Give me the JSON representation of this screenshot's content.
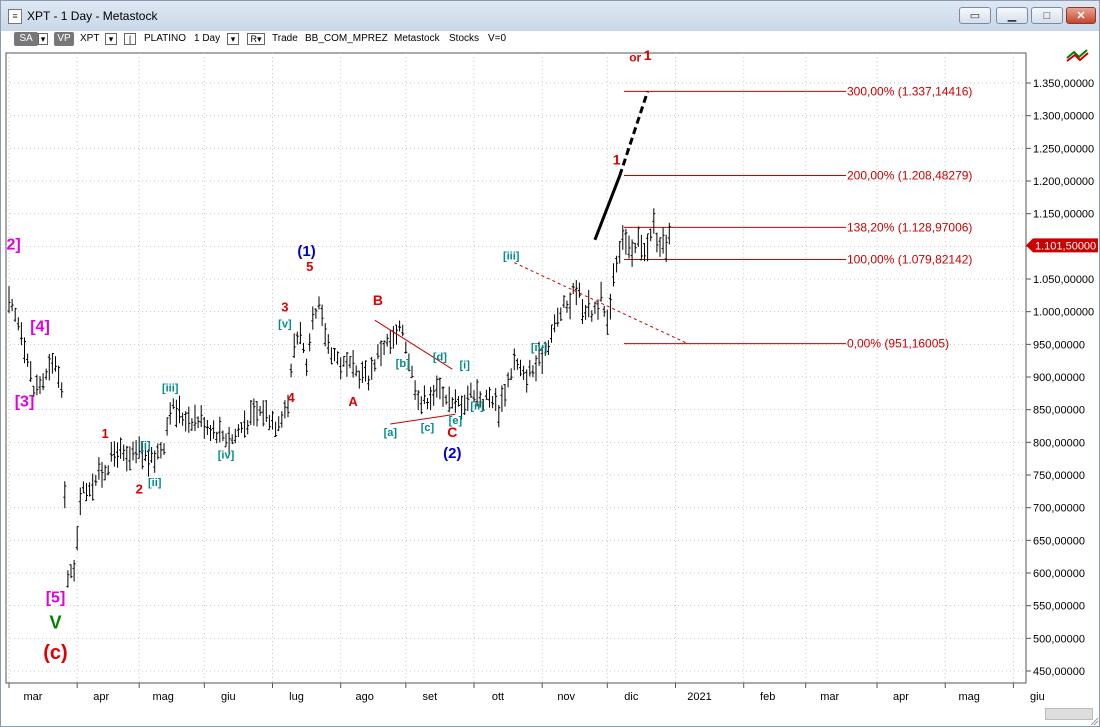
{
  "window": {
    "title": "XPT - 1 Day - Metastock"
  },
  "toolbar": {
    "sa": "SA",
    "vp": "VP",
    "symbol": "XPT",
    "name": "PLATINO",
    "period": "1 Day",
    "r": "R",
    "mode": "Trade",
    "bb": "BB_COM_MPREZ",
    "src": "Metastock",
    "cat": "Stocks",
    "v": "V=0"
  },
  "chart_data": {
    "type": "ohlc",
    "symbol": "XPT",
    "name": "PLATINO",
    "period": "1 Day",
    "last_value": 1101.5,
    "last_label": "1.101,50000",
    "ylim": [
      420,
      1420
    ],
    "y_ticks": [
      450,
      500,
      550,
      600,
      650,
      700,
      750,
      800,
      850,
      900,
      950,
      1000,
      1050,
      1100,
      1150,
      1200,
      1250,
      1300,
      1350
    ],
    "y_tick_labels": [
      "450,00000",
      "500,00000",
      "550,00000",
      "600,00000",
      "650,00000",
      "700,00000",
      "750,00000",
      "800,00000",
      "850,00000",
      "900,00000",
      "950,00000",
      "1.000,00000",
      "1.050,00000",
      "1.100,00000",
      "1.150,00000",
      "1.200,00000",
      "1.250,00000",
      "1.300,00000",
      "1.350,00000"
    ],
    "grid": true,
    "months": [
      {
        "label": "mar",
        "idx": 0
      },
      {
        "label": "apr",
        "idx": 22
      },
      {
        "label": "mag",
        "idx": 42
      },
      {
        "label": "giu",
        "idx": 63
      },
      {
        "label": "lug",
        "idx": 85
      },
      {
        "label": "ago",
        "idx": 107
      },
      {
        "label": "set",
        "idx": 128
      },
      {
        "label": "ott",
        "idx": 150
      },
      {
        "label": "nov",
        "idx": 172
      },
      {
        "label": "dic",
        "idx": 193
      },
      {
        "label": "2021",
        "idx": 215
      },
      {
        "label": "feb",
        "idx": 237
      },
      {
        "label": "mar",
        "idx": 257
      },
      {
        "label": "apr",
        "idx": 280
      },
      {
        "label": "mag",
        "idx": 302
      },
      {
        "label": "giu",
        "idx": 324
      }
    ],
    "price_path": [
      [
        0,
        1010
      ],
      [
        4,
        975
      ],
      [
        8,
        880
      ],
      [
        12,
        900
      ],
      [
        15,
        925
      ],
      [
        17,
        870
      ],
      [
        19,
        590
      ],
      [
        21,
        600
      ],
      [
        23,
        720
      ],
      [
        27,
        740
      ],
      [
        31,
        760
      ],
      [
        35,
        790
      ],
      [
        38,
        770
      ],
      [
        42,
        785
      ],
      [
        46,
        770
      ],
      [
        50,
        800
      ],
      [
        52,
        855
      ],
      [
        56,
        840
      ],
      [
        62,
        835
      ],
      [
        66,
        820
      ],
      [
        72,
        805
      ],
      [
        76,
        830
      ],
      [
        82,
        850
      ],
      [
        86,
        830
      ],
      [
        90,
        860
      ],
      [
        92,
        950
      ],
      [
        94,
        975
      ],
      [
        96,
        905
      ],
      [
        98,
        980
      ],
      [
        100,
        1005
      ],
      [
        103,
        950
      ],
      [
        107,
        920
      ],
      [
        111,
        910
      ],
      [
        116,
        900
      ],
      [
        118,
        925
      ],
      [
        121,
        950
      ],
      [
        124,
        955
      ],
      [
        127,
        975
      ],
      [
        130,
        905
      ],
      [
        133,
        860
      ],
      [
        136,
        875
      ],
      [
        140,
        880
      ],
      [
        143,
        855
      ],
      [
        147,
        865
      ],
      [
        150,
        880
      ],
      [
        153,
        865
      ],
      [
        156,
        870
      ],
      [
        158,
        850
      ],
      [
        160,
        880
      ],
      [
        163,
        925
      ],
      [
        166,
        900
      ],
      [
        170,
        915
      ],
      [
        174,
        955
      ],
      [
        178,
        1000
      ],
      [
        181,
        1015
      ],
      [
        183,
        1040
      ],
      [
        185,
        1010
      ],
      [
        188,
        1000
      ],
      [
        191,
        1020
      ],
      [
        193,
        975
      ],
      [
        195,
        1060
      ],
      [
        198,
        1120
      ],
      [
        201,
        1080
      ],
      [
        203,
        1110
      ],
      [
        206,
        1095
      ],
      [
        208,
        1135
      ],
      [
        210,
        1090
      ],
      [
        213,
        1115
      ]
    ],
    "levels": [
      {
        "label": "300,00% (1.337,14416)",
        "value": 1337.14416
      },
      {
        "label": "200,00% (1.208,48279)",
        "value": 1208.48279
      },
      {
        "label": "138,20% (1.128,97006)",
        "value": 1128.97006
      },
      {
        "label": "100,00% (1.079,82142)",
        "value": 1079.82142
      },
      {
        "label": "0,00% (951,16005)",
        "value": 951.16005
      }
    ],
    "wave_labels": [
      {
        "text": "2]",
        "idx": 1.5,
        "value": 1095,
        "color": "#e000e0",
        "size": 16
      },
      {
        "text": "[4]",
        "idx": 10,
        "value": 970,
        "color": "#e000e0",
        "size": 16
      },
      {
        "text": "[3]",
        "idx": 5,
        "value": 855,
        "color": "#e000e0",
        "size": 16
      },
      {
        "text": "[5]",
        "idx": 15,
        "value": 555,
        "color": "#e000e0",
        "size": 16
      },
      {
        "text": "V",
        "idx": 15,
        "value": 515,
        "color": "#008000",
        "size": 18
      },
      {
        "text": "(c)",
        "idx": 15,
        "value": 468,
        "color": "#e00000",
        "size": 20
      },
      {
        "text": "1",
        "idx": 31,
        "value": 807,
        "color": "#e00000",
        "size": 13
      },
      {
        "text": "2",
        "idx": 42,
        "value": 722,
        "color": "#e00000",
        "size": 13
      },
      {
        "text": "[i]",
        "idx": 44,
        "value": 790,
        "color": "#008b8b",
        "size": 11
      },
      {
        "text": "[ii]",
        "idx": 47,
        "value": 733,
        "color": "#008b8b",
        "size": 11
      },
      {
        "text": "[iii]",
        "idx": 52,
        "value": 878,
        "color": "#008b8b",
        "size": 11
      },
      {
        "text": "[iv]",
        "idx": 70,
        "value": 775,
        "color": "#008b8b",
        "size": 11
      },
      {
        "text": "3",
        "idx": 89,
        "value": 1000,
        "color": "#e00000",
        "size": 13
      },
      {
        "text": "[v]",
        "idx": 89,
        "value": 976,
        "color": "#008b8b",
        "size": 11
      },
      {
        "text": "4",
        "idx": 91,
        "value": 862,
        "color": "#e00000",
        "size": 13
      },
      {
        "text": "(1)",
        "idx": 96,
        "value": 1085,
        "color": "#0000cc",
        "size": 15
      },
      {
        "text": "5",
        "idx": 97,
        "value": 1062,
        "color": "#e00000",
        "size": 13
      },
      {
        "text": "A",
        "idx": 111,
        "value": 856,
        "color": "#e00000",
        "size": 13
      },
      {
        "text": "B",
        "idx": 119,
        "value": 1010,
        "color": "#e00000",
        "size": 14
      },
      {
        "text": "[a]",
        "idx": 123,
        "value": 810,
        "color": "#008b8b",
        "size": 11
      },
      {
        "text": "[b]",
        "idx": 127,
        "value": 915,
        "color": "#008b8b",
        "size": 11
      },
      {
        "text": "[c]",
        "idx": 135,
        "value": 817,
        "color": "#008b8b",
        "size": 11
      },
      {
        "text": "[d]",
        "idx": 139,
        "value": 925,
        "color": "#008b8b",
        "size": 11
      },
      {
        "text": "[e]",
        "idx": 144,
        "value": 828,
        "color": "#008b8b",
        "size": 11
      },
      {
        "text": "C",
        "idx": 143,
        "value": 808,
        "color": "#e00000",
        "size": 14
      },
      {
        "text": "(2)",
        "idx": 143,
        "value": 776,
        "color": "#0000cc",
        "size": 15
      },
      {
        "text": "[i]",
        "idx": 147,
        "value": 913,
        "color": "#008b8b",
        "size": 11
      },
      {
        "text": "[ii]",
        "idx": 151,
        "value": 850,
        "color": "#008b8b",
        "size": 11
      },
      {
        "text": "[iii]",
        "idx": 162,
        "value": 1080,
        "color": "#008b8b",
        "size": 11
      },
      {
        "text": "[iv]",
        "idx": 171,
        "value": 940,
        "color": "#008b8b",
        "size": 11
      },
      {
        "text": "1",
        "idx": 196,
        "value": 1225,
        "color": "#e00000",
        "size": 14
      },
      {
        "text": "or",
        "idx": 202,
        "value": 1383,
        "color": "#e00000",
        "size": 12
      },
      {
        "text": "1",
        "idx": 206,
        "value": 1385,
        "color": "#e00000",
        "size": 14
      }
    ],
    "trendlines": [
      {
        "from": [
          118,
          987
        ],
        "to": [
          143,
          912
        ],
        "color": "#cc0000",
        "dash": false
      },
      {
        "from": [
          123,
          828
        ],
        "to": [
          144,
          843
        ],
        "color": "#cc0000",
        "dash": false
      },
      {
        "from": [
          163,
          1075
        ],
        "to": [
          219,
          951
        ],
        "color": "#cc0000",
        "dash": true
      },
      {
        "from": [
          189,
          1110
        ],
        "to": [
          197,
          1208
        ],
        "color": "#000000",
        "dash": false,
        "width": 3
      },
      {
        "from": [
          197,
          1208
        ],
        "to": [
          206,
          1337
        ],
        "color": "#000000",
        "dash": true,
        "width": 3
      }
    ]
  }
}
